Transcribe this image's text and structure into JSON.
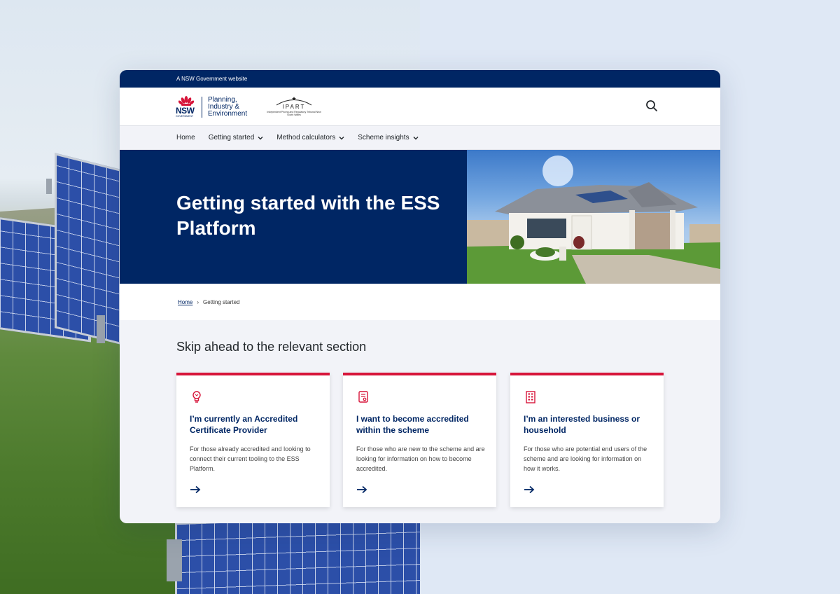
{
  "site": {
    "gov_banner": "A NSW Government website",
    "nsw_logo_text": "NSW",
    "nsw_logo_sub": "GOVERNMENT",
    "dept_line1": "Planning,",
    "dept_line2": "Industry &",
    "dept_line3": "Environment",
    "ipart_name": "IPART",
    "ipart_sub": "Independent Pricing and Regulatory Tribunal New South Wales"
  },
  "nav": {
    "items": [
      {
        "label": "Home",
        "dropdown": false
      },
      {
        "label": "Getting started",
        "dropdown": true
      },
      {
        "label": "Method calculators",
        "dropdown": true
      },
      {
        "label": "Scheme insights",
        "dropdown": true
      }
    ]
  },
  "hero": {
    "title": "Getting started with the ESS Platform"
  },
  "breadcrumb": {
    "home": "Home",
    "separator": "›",
    "current": "Getting started"
  },
  "main": {
    "section_title": "Skip ahead to the relevant section",
    "tiles": [
      {
        "icon": "lightbulb-icon",
        "title": "I’m currently an Accredited Certificate Provider",
        "description": "For those already accredited and looking to connect their current tooling to the ESS Platform."
      },
      {
        "icon": "certificate-document-icon",
        "title": "I want to become accredited within the scheme",
        "description": "For those who are new to the scheme and are looking for information on how to become accredited."
      },
      {
        "icon": "building-icon",
        "title": "I’m an interested business or household",
        "description": "For those who are potential end users of the scheme and are looking for information on how it works."
      }
    ]
  },
  "colors": {
    "navy": "#002664",
    "accent_red": "#d7153a",
    "page_bg": "#dfe8f5"
  }
}
